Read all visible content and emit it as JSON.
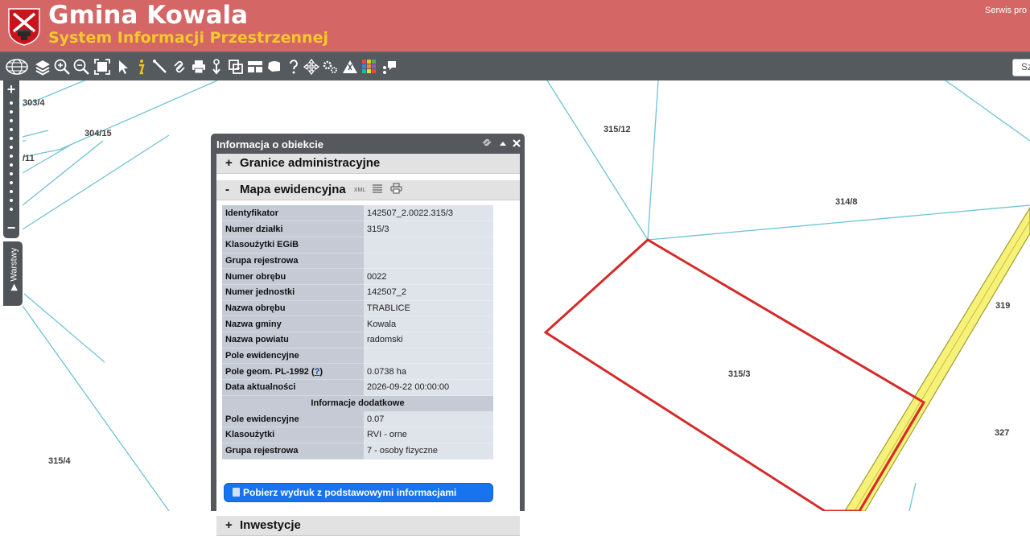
{
  "header": {
    "title": "Gmina Kowala",
    "subtitle": "System Informacji Przestrzennej",
    "service_link": "Serwis pro"
  },
  "toolbar": {
    "search_label": "Sz",
    "icons": [
      "globe-icon",
      "layers-icon",
      "zoom-in-icon",
      "zoom-out-icon",
      "zoom-extent-icon",
      "select-arrow-icon",
      "info-icon",
      "measure-line-icon",
      "link-icon",
      "print-icon",
      "download-icon",
      "copy-map-icon",
      "table-icon",
      "shape-icon",
      "help-icon",
      "pan-icon",
      "settings-icon",
      "warning-icon",
      "palette-icon",
      "comment-icon"
    ]
  },
  "map": {
    "labels": {
      "p303_4": "303/4",
      "p304_15": "304/15",
      "p_11": "/11",
      "p315_12": "315/12",
      "p314_8": "314/8",
      "p319": "319",
      "p315_3": "315/3",
      "p327": "327",
      "p315_4": "315/4"
    },
    "colors": {
      "parcel_lines": "#6fc2d6",
      "selected_parcel": "#d62a2a",
      "road_fill": "#f7f17a",
      "road_edge": "#9ba02c"
    }
  },
  "zoom": {
    "plus": "+",
    "minus": "−"
  },
  "layers_tab": {
    "label": "▶ Warstwy"
  },
  "panel": {
    "title": "Informacja o obiekcie",
    "sections": {
      "admin": {
        "sign": "+",
        "label": "Granice administracyjne"
      },
      "cadastre": {
        "sign": "-",
        "label": "Mapa ewidencyjna",
        "xml_label": "XML"
      },
      "investments": {
        "sign": "+",
        "label": "Inwestycje"
      }
    },
    "attributes": [
      {
        "label": "Identyfikator",
        "value": "142507_2.0022.315/3"
      },
      {
        "label": "Numer działki",
        "value": "315/3"
      },
      {
        "label": "Klasoużytki EGiB",
        "value": ""
      },
      {
        "label": "Grupa rejestrowa",
        "value": ""
      },
      {
        "label": "Numer obrębu",
        "value": "0022"
      },
      {
        "label": "Numer jednostki",
        "value": "142507_2"
      },
      {
        "label": "Nazwa obrębu",
        "value": "TRABLICE"
      },
      {
        "label": "Nazwa gminy",
        "value": "Kowala"
      },
      {
        "label": "Nazwa powiatu",
        "value": "radomski"
      },
      {
        "label": "Pole ewidencyjne",
        "value": ""
      },
      {
        "label": "Pole geom. PL-1992",
        "link": "?",
        "value": "0.0738 ha"
      },
      {
        "label": "Data aktualności",
        "value": "2026-09-22 00:00:00"
      }
    ],
    "extra_heading": "Informacje dodatkowe",
    "extra_attributes": [
      {
        "label": "Pole ewidencyjne",
        "value": "0.07"
      },
      {
        "label": "Klasoużytki",
        "value": "RVI - orne"
      },
      {
        "label": "Grupa rejestrowa",
        "value": "7 - osoby fizyczne"
      }
    ],
    "print_button": "Pobierz wydruk z podstawowymi informacjami"
  }
}
